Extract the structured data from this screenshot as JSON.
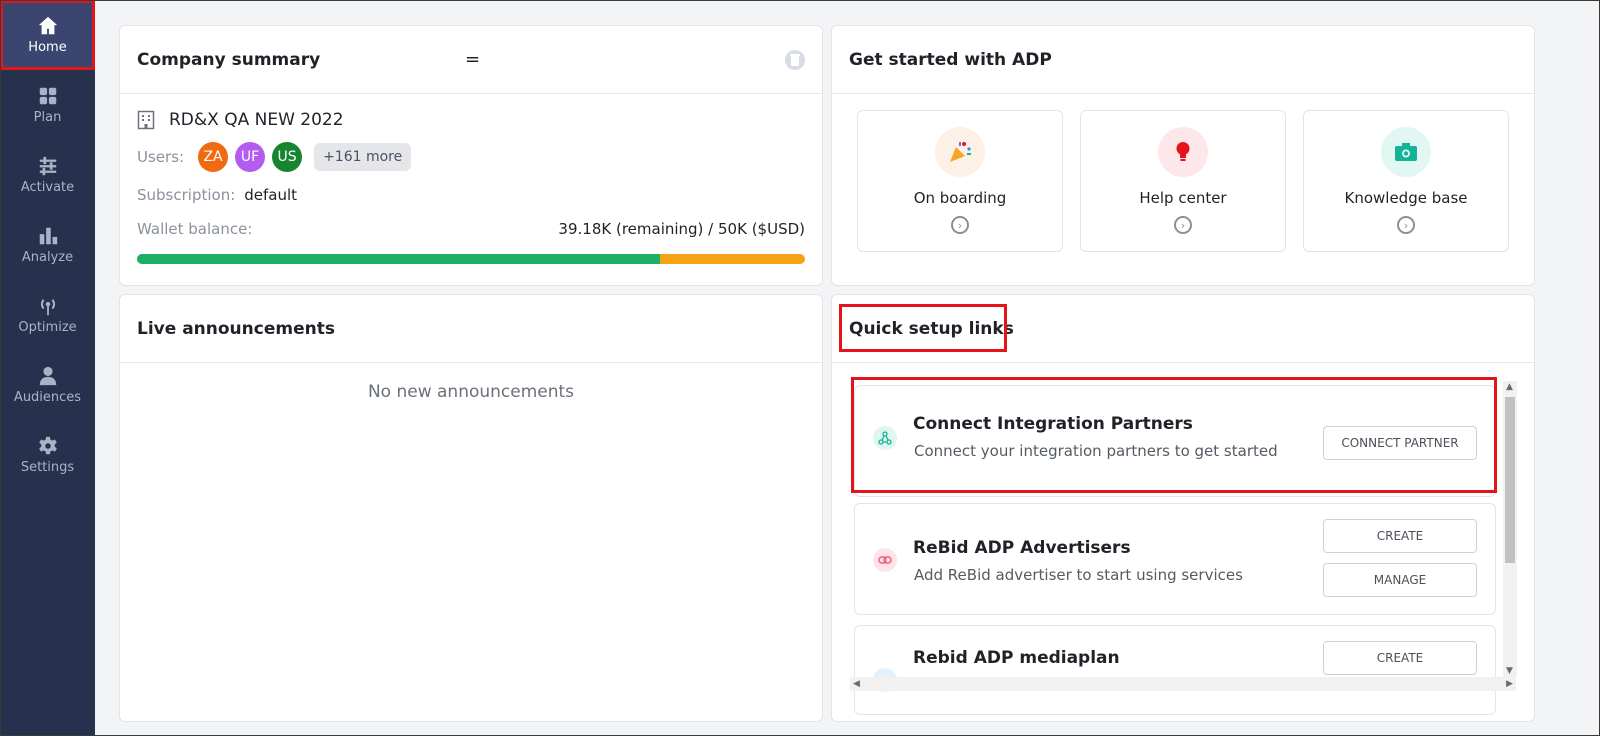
{
  "sidebar": {
    "items": [
      {
        "label": "Home",
        "icon": "home-icon"
      },
      {
        "label": "Plan",
        "icon": "grid-icon"
      },
      {
        "label": "Activate",
        "icon": "sliders-icon"
      },
      {
        "label": "Analyze",
        "icon": "bar-chart-icon"
      },
      {
        "label": "Optimize",
        "icon": "broadcast-icon"
      },
      {
        "label": "Audiences",
        "icon": "person-icon"
      },
      {
        "label": "Settings",
        "icon": "gear-icon"
      }
    ],
    "active": "Home"
  },
  "summary": {
    "title": "Company summary",
    "menu_glyph": "=",
    "company": "RD&X QA NEW 2022",
    "users_label": "Users:",
    "users": [
      {
        "initials": "ZA",
        "color": "#f06a12"
      },
      {
        "initials": "UF",
        "color": "#b45cf0"
      },
      {
        "initials": "US",
        "color": "#17852f"
      }
    ],
    "more": "+161 more",
    "subscription_label": "Subscription:",
    "subscription_value": "default",
    "wallet_label": "Wallet balance:",
    "wallet_value": "39.18K (remaining) / 50K ($USD)",
    "wallet_used_fraction": 0.783
  },
  "getstarted": {
    "title": "Get started with ADP",
    "tiles": [
      {
        "label": "On boarding",
        "icon": "party-popper-icon",
        "bg": "#fdf0e6"
      },
      {
        "label": "Help center",
        "icon": "lightbulb-icon",
        "bg": "#fde7ea"
      },
      {
        "label": "Knowledge base",
        "icon": "camera-icon",
        "bg": "#e2f6f2"
      }
    ]
  },
  "announcements": {
    "title": "Live announcements",
    "empty": "No new announcements"
  },
  "quicksetup": {
    "title": "Quick setup links",
    "items": [
      {
        "title": "Connect Integration Partners",
        "desc": "Connect your integration partners to get started",
        "buttons": [
          "CONNECT PARTNER"
        ],
        "icon": "share-nodes-icon",
        "icon_bg": "#dff5ef"
      },
      {
        "title": "ReBid ADP Advertisers",
        "desc": "Add ReBid advertiser to start using services",
        "buttons": [
          "CREATE",
          "MANAGE"
        ],
        "icon": "link-icon",
        "icon_bg": "#fde4e8"
      },
      {
        "title": "Rebid ADP mediaplan",
        "desc": "",
        "buttons": [
          "CREATE"
        ],
        "icon": "pin-icon",
        "icon_bg": "#e3f1fc"
      }
    ]
  }
}
